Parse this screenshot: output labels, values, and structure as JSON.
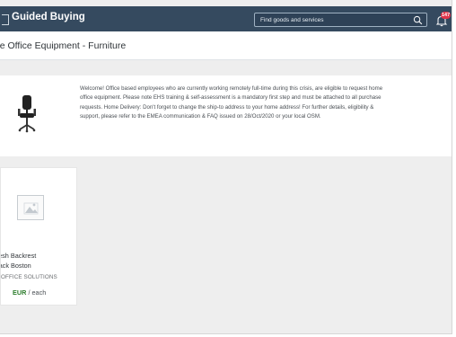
{
  "header": {
    "app_title": "Guided Buying",
    "search_placeholder": "Find goods and services",
    "notification_count": "147"
  },
  "page": {
    "title": "me Office Equipment - Furniture"
  },
  "banner": {
    "lines": [
      "Welcome! Office based employees who are currently working remotely full-time during this crisis, are eligible to request home",
      "office equipment.  Please note EHS training & self-assessment is a mandatory first step and must be attached to all purchase",
      "requests. Home Delivery: Don't forget to change the ship-to address to your home address! For further details, eligibility &",
      "support, please refer to the EMEA communication & FAQ issued on 28/Oct/2020 or your local OSM."
    ]
  },
  "product": {
    "name_line1": "Mesh Backrest",
    "name_line2": "lack Boston",
    "supplier": "OFFICE SOLUTIONS",
    "currency": "EUR",
    "unit": "/ each"
  },
  "colors": {
    "shell_bar": "#354a5f",
    "badge": "#e0344a",
    "price": "#2b7c2b"
  }
}
